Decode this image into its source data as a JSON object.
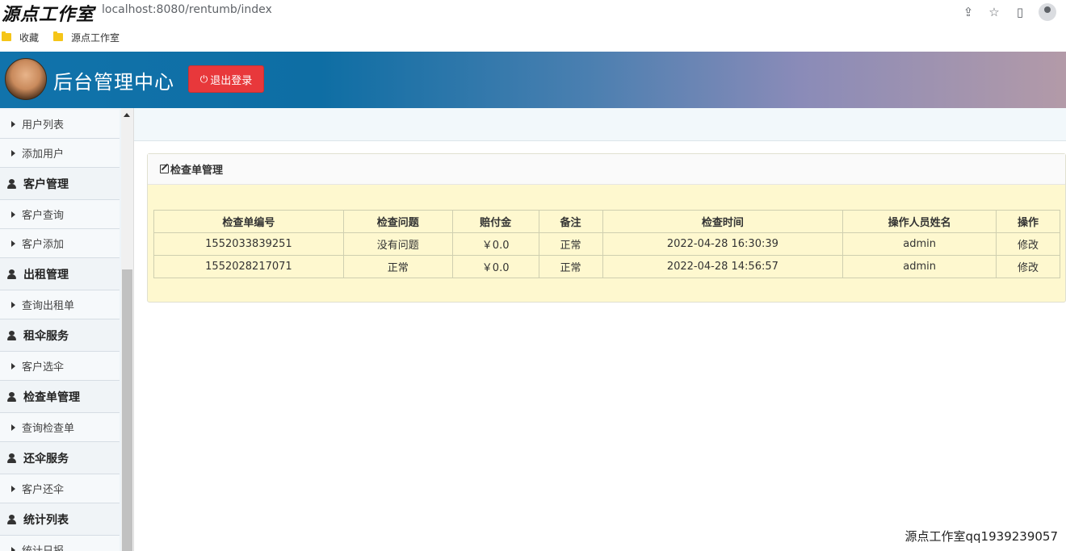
{
  "browser": {
    "watermark": "源点工作室",
    "url": "localhost:8080/rentumb/index",
    "bookmarks": [
      "收藏",
      "源点工作室"
    ]
  },
  "header": {
    "title": "后台管理中心",
    "logout_label": "退出登录",
    "colors": {
      "logout": "#e8383b",
      "header_start": "#1173ab",
      "header_end": "#b39aa8"
    }
  },
  "sidebar": {
    "items": [
      {
        "type": "sub",
        "label": "用户列表"
      },
      {
        "type": "sub",
        "label": "添加用户"
      },
      {
        "type": "group",
        "label": "客户管理"
      },
      {
        "type": "sub",
        "label": "客户查询"
      },
      {
        "type": "sub",
        "label": "客户添加"
      },
      {
        "type": "group",
        "label": "出租管理"
      },
      {
        "type": "sub",
        "label": "查询出租单"
      },
      {
        "type": "group",
        "label": "租伞服务"
      },
      {
        "type": "sub",
        "label": "客户选伞"
      },
      {
        "type": "group",
        "label": "检查单管理"
      },
      {
        "type": "sub",
        "label": "查询检查单"
      },
      {
        "type": "group",
        "label": "还伞服务"
      },
      {
        "type": "sub",
        "label": "客户还伞"
      },
      {
        "type": "group",
        "label": "统计列表"
      },
      {
        "type": "sub",
        "label": "统计日报"
      }
    ]
  },
  "panel": {
    "title": "检查单管理",
    "table": {
      "headers": [
        "检查单编号",
        "检查问题",
        "赔付金",
        "备注",
        "检查时间",
        "操作人员姓名",
        "操作"
      ],
      "rows": [
        [
          "1552033839251",
          "没有问题",
          "￥0.0",
          "正常",
          "2022-04-28 16:30:39",
          "admin",
          "修改"
        ],
        [
          "1552028217071",
          "正常",
          "￥0.0",
          "正常",
          "2022-04-28 14:56:57",
          "admin",
          "修改"
        ]
      ]
    }
  },
  "footer": {
    "watermark": "源点工作室qq1939239057"
  }
}
